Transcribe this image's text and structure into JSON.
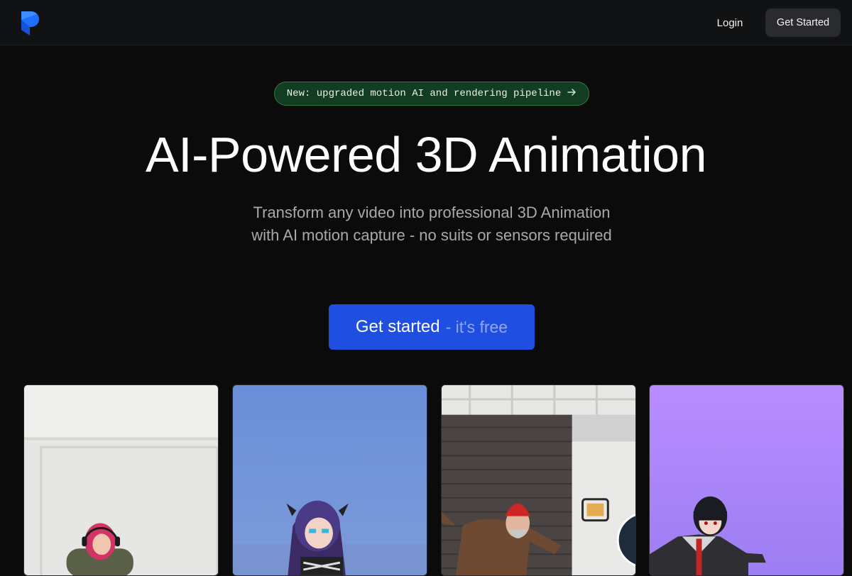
{
  "header": {
    "logo_icon": "brand-logo-icon",
    "login_label": "Login",
    "cta_label": "Get Started"
  },
  "announcement": {
    "text": "New: upgraded motion AI and rendering pipeline",
    "icon": "arrow-right-icon"
  },
  "hero": {
    "title": "AI-Powered 3D Animation",
    "subtitle": "Transform any video into professional 3D Animation with AI motion capture - no suits or sensors required",
    "cta_main": "Get started",
    "cta_suffix": "- it's free"
  },
  "colors": {
    "background": "#0b0b0c",
    "accent": "#1f4fe0",
    "badge_bg": "#123d22",
    "badge_border": "#2e7d46"
  },
  "gallery": [
    {
      "name": "woman-with-headphones-video"
    },
    {
      "name": "anime-avatar-render"
    },
    {
      "name": "man-dancing-video"
    },
    {
      "name": "anime-boy-avatar-render"
    }
  ]
}
